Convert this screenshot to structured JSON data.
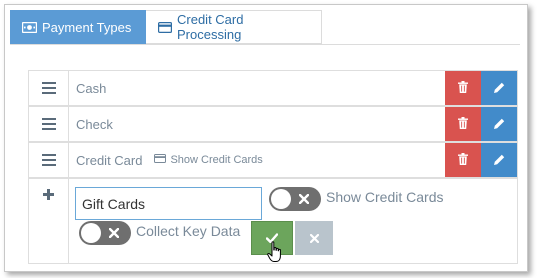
{
  "tabs": [
    {
      "label": "Payment Types",
      "icon": "money-icon",
      "active": true
    },
    {
      "label": "Credit Card Processing",
      "icon": "credit-card-icon",
      "active": false
    }
  ],
  "payment_types": [
    {
      "label": "Cash"
    },
    {
      "label": "Check"
    },
    {
      "label": "Credit Card",
      "sub_link": "Show Credit Cards"
    }
  ],
  "new_item": {
    "value": "Gift Cards",
    "toggle_show_credit_cards": {
      "label": "Show Credit Cards",
      "on": false
    },
    "toggle_collect_key_data": {
      "label": "Collect Key Data",
      "on": false
    }
  },
  "colors": {
    "tab_active": "#5b9bd5",
    "delete": "#d9534f",
    "edit": "#428bca",
    "save": "#6ca55c",
    "cancel": "#b9c4cc"
  }
}
